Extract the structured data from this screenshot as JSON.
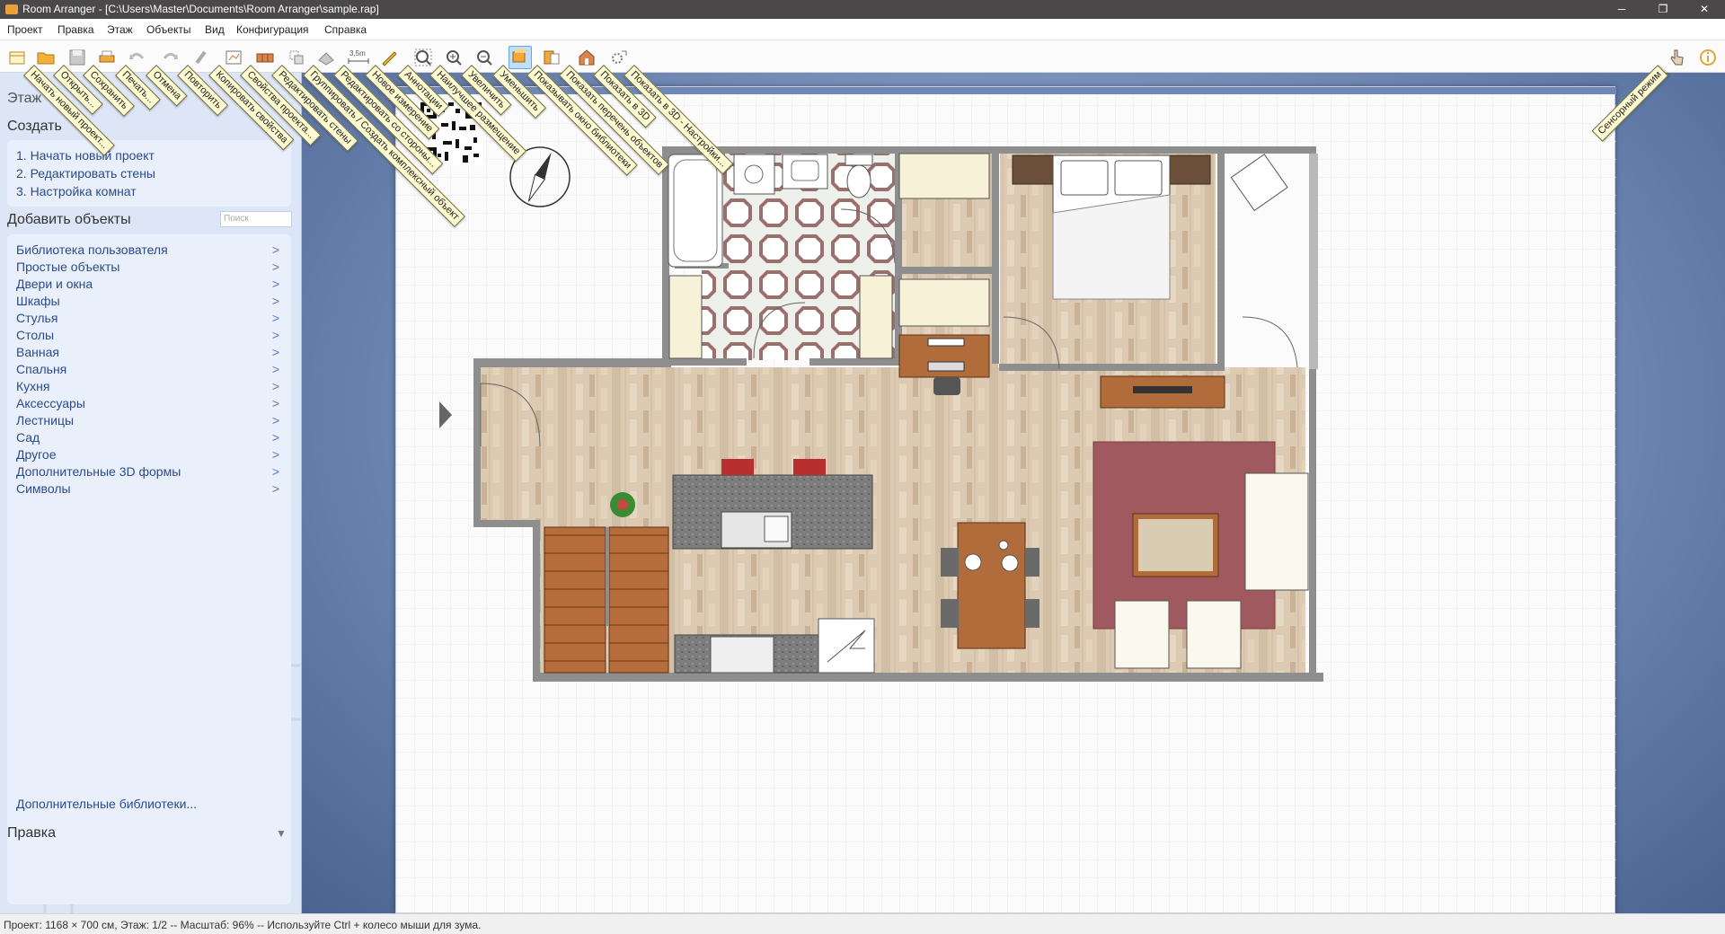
{
  "window": {
    "title": "Room Arranger - [C:\\Users\\Master\\Documents\\Room Arranger\\sample.rap]",
    "buttons": [
      "─",
      "❐",
      "✕"
    ]
  },
  "menu": [
    "Проект",
    "Правка",
    "Этаж",
    "Объекты",
    "Вид",
    "Конфигурация",
    "Справка"
  ],
  "toolbar": {
    "dimension_label": "3,5m",
    "tooltips": [
      "Начать новый проект...",
      "Открыть...",
      "Сохранить",
      "Печать...",
      "Отмена",
      "Повторить",
      "Копировать свойства",
      "Свойства проекта...",
      "Редактировать стены",
      "Группировать / Создать комплексный объект",
      "Редактировать со стороны...",
      "Новое измерение",
      "Аннотации",
      "Наилучшее размещение",
      "Увеличить",
      "Уменьшить",
      "Показывать окно библиотеки",
      "Показать перечень объектов",
      "Показать в 3D",
      "Показать в 3D - Настройки..."
    ],
    "right_tooltip": "Сенсорный режим",
    "icons": [
      "new-project-icon",
      "open-folder-icon",
      "save-icon",
      "print-icon",
      "undo-icon",
      "redo-icon",
      "copy-properties-icon",
      "project-properties-icon",
      "edit-walls-icon",
      "group-icon",
      "edit-side-icon",
      "dimension-icon",
      "annotation-icon",
      "best-fit-icon",
      "zoom-in-icon",
      "zoom-out-icon",
      "library-window-icon",
      "object-list-icon",
      "show-3d-icon",
      "3d-settings-icon"
    ]
  },
  "sidebar": {
    "floor_title": "Этаж",
    "create": {
      "title": "Создать",
      "steps": [
        "1. Начать новый проект",
        "2. Редактировать стены",
        "3. Настройка комнат"
      ]
    },
    "add_objects": {
      "title": "Добавить объекты",
      "search_placeholder": "Поиск",
      "categories": [
        "Библиотека пользователя",
        "Простые объекты",
        "Двери и окна",
        "Шкафы",
        "Стулья",
        "Столы",
        "Ванная",
        "Спальня",
        "Кухня",
        "Аксессуары",
        "Лестницы",
        "Сад",
        "Другое",
        "Дополнительные 3D формы",
        "Символы"
      ],
      "arrow": ">",
      "more_libraries": "Дополнительные библиотеки..."
    },
    "edit": {
      "title": "Правка",
      "toggle": "▼"
    }
  },
  "status": {
    "text": "Проект: 1168 × 700 см, Этаж: 1/2 -- Масштаб: 96% -- Используйте Ctrl + колесо мыши для зума."
  },
  "colors": {
    "titlebar": "#4a4848",
    "sidebar": "#dde6f7",
    "link": "#2b4b8c",
    "tooltip": "#fffbd1",
    "canvas": "#6d85b1",
    "wall": "#8e8e8e",
    "wood_floor": "#d9c6ad",
    "rug": "#a05a5f",
    "table_wood": "#b06c3a",
    "countertop": "#6e6e6e"
  }
}
